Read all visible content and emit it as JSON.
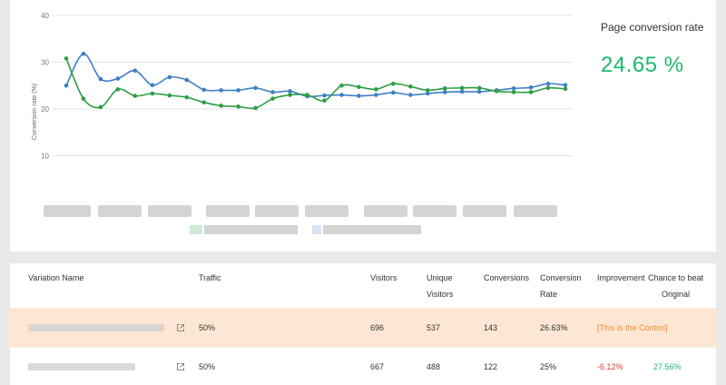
{
  "kpi": {
    "title": "Page conversion rate",
    "value": "24.65 %"
  },
  "chart_data": {
    "type": "line",
    "ylabel": "Conversion rate (%)",
    "ylim": [
      0,
      40
    ],
    "yticks": [
      10,
      20,
      30,
      40
    ],
    "grid": true,
    "series": [
      {
        "color": "#3f7fc6",
        "values": [
          25,
          31.8,
          26.4,
          26.5,
          28.2,
          25.1,
          26.8,
          26.2,
          24.1,
          24.0,
          24.0,
          24.5,
          23.6,
          23.8,
          22.7,
          22.9,
          23.0,
          22.8,
          23.0,
          23.5,
          23.0,
          23.3,
          23.6,
          23.7,
          23.7,
          24.0,
          24.4,
          24.6,
          25.4,
          25.1
        ]
      },
      {
        "color": "#2e9e44",
        "values": [
          30.8,
          22.2,
          20.4,
          24.2,
          22.8,
          23.3,
          22.9,
          22.5,
          21.4,
          20.7,
          20.5,
          20.2,
          22.2,
          23.0,
          23.0,
          21.8,
          25.0,
          24.7,
          24.2,
          25.4,
          24.8,
          24.0,
          24.4,
          24.5,
          24.5,
          23.8,
          23.6,
          23.6,
          24.5,
          24.3
        ]
      }
    ]
  },
  "table": {
    "headers": {
      "variation_name": "Variation Name",
      "traffic": "Traffic",
      "visitors": "Visitors",
      "unique_visitors_1": "Unique",
      "unique_visitors_2": "Visitors",
      "conversions": "Conversions",
      "conversion_rate_1": "Conversion",
      "conversion_rate_2": "Rate",
      "improvement": "Improvement",
      "chance_1": "Chance to beat",
      "chance_2": "Original"
    },
    "rows": [
      {
        "traffic": "50%",
        "visitors": "696",
        "unique_visitors": "537",
        "conversions": "143",
        "conversion_rate": "26.63%",
        "improvement": "[This is the Control]",
        "chance": ""
      },
      {
        "traffic": "50%",
        "visitors": "667",
        "unique_visitors": "488",
        "conversions": "122",
        "conversion_rate": "25%",
        "improvement": "-6.12%",
        "chance": "27.56%"
      }
    ]
  },
  "icons": {
    "external_link": "external-link-icon"
  }
}
